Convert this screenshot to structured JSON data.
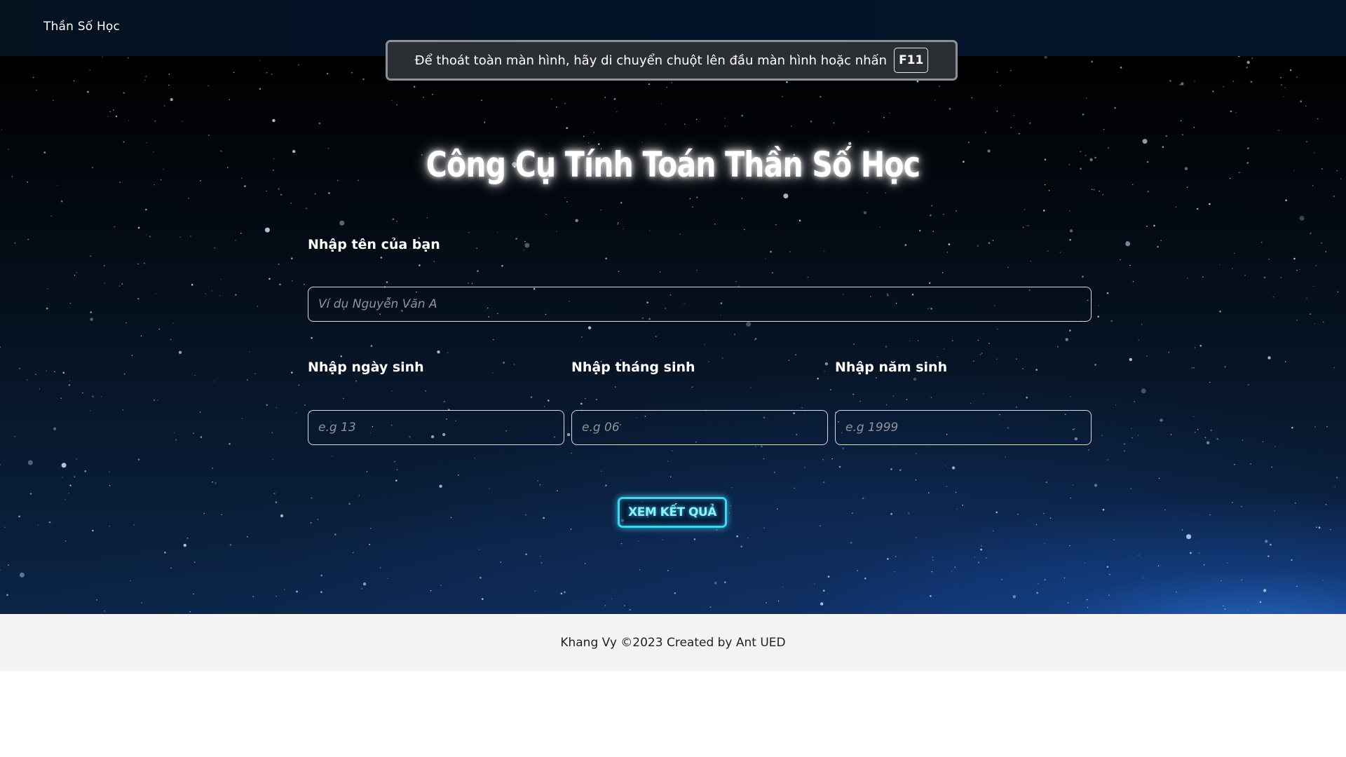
{
  "header": {
    "brand": "Thần Số Học"
  },
  "fullscreen_notice": {
    "message": "Để thoát toàn màn hình, hãy di chuyển chuột lên đầu màn hình hoặc nhấn",
    "key": "F11"
  },
  "main": {
    "title": "Công Cụ Tính Toán Thần Số Học",
    "name": {
      "label": "Nhập tên của bạn",
      "placeholder": "Ví dụ Nguyễn Văn A",
      "value": ""
    },
    "day": {
      "label": "Nhập ngày sinh",
      "placeholder": "e.g 13",
      "value": ""
    },
    "month": {
      "label": "Nhập tháng sinh",
      "placeholder": "e.g 06",
      "value": ""
    },
    "year": {
      "label": "Nhập năm sinh",
      "placeholder": "e.g 1999",
      "value": ""
    },
    "submit_label": "XEM KẾT QUẢ"
  },
  "footer": {
    "text": "Khang Vy ©2023 Created by Ant UED"
  },
  "colors": {
    "header_bg": "#021329",
    "button_glow": "#3fd6f5",
    "footer_bg": "#f4f4f4"
  }
}
